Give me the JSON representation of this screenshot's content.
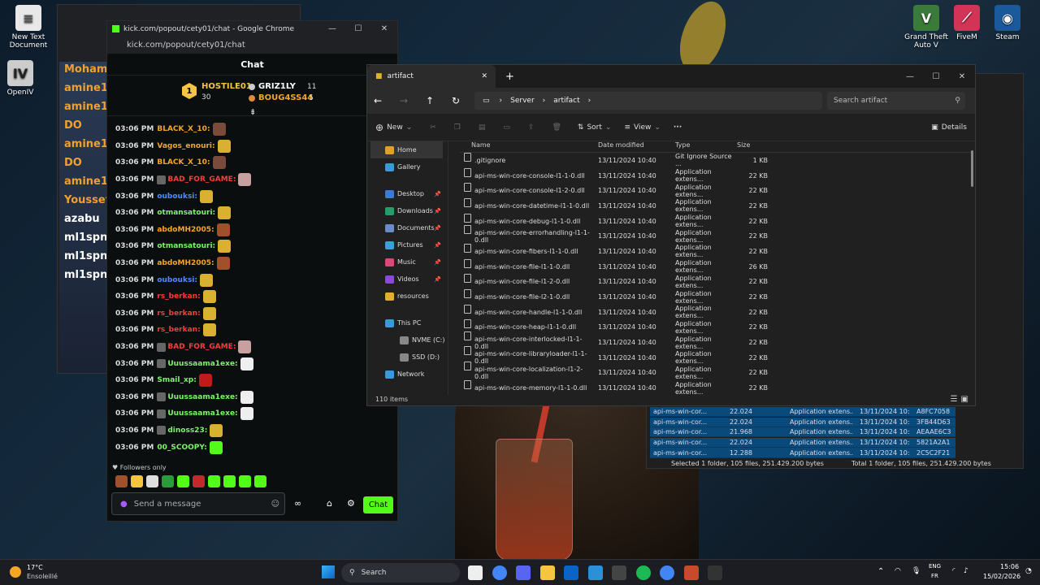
{
  "desktop": {
    "icons": [
      {
        "label": "New Text Document",
        "glyph": "≡",
        "color": "#e8e8e8"
      },
      {
        "label": "OpenIV",
        "glyph": "IV",
        "color": "#cccccc"
      },
      {
        "label": "Grand Theft Auto V",
        "glyph": "V",
        "color": "#3a7a3a"
      },
      {
        "label": "FiveM",
        "glyph": "⟋",
        "color": "#d33356"
      },
      {
        "label": "Steam",
        "glyph": "◉",
        "color": "#1b5a9a"
      }
    ]
  },
  "chat_window": {
    "tab_title": "kick.com/popout/cety01/chat - Google Chrome",
    "url": "kick.com/popout/cety01/chat",
    "header": "Chat",
    "leaderboard": {
      "first_rank": "1",
      "first_name": "HOSTILE01",
      "first_count": "30",
      "second_name": "GRIZ1LY",
      "second_count": "11",
      "third_name": "BOUG4SS44",
      "third_count": "5"
    },
    "messages": [
      {
        "time": "03:06 PM",
        "user": "BLACK_X_10:",
        "color": "#f5a623"
      },
      {
        "time": "03:06 PM",
        "user": "Vagos_enouri:",
        "color": "#f5a623"
      },
      {
        "time": "03:06 PM",
        "user": "BLACK_X_10:",
        "color": "#f5a623"
      },
      {
        "time": "03:06 PM",
        "user": "BAD_FOR_GAME:",
        "color": "#ff3b3b"
      },
      {
        "time": "03:06 PM",
        "user": "oubouksi:",
        "color": "#4c8dff"
      },
      {
        "time": "03:06 PM",
        "user": "otmansatouri:",
        "color": "#7cf56a"
      },
      {
        "time": "03:06 PM",
        "user": "abdoMH2005:",
        "color": "#f5a623"
      },
      {
        "time": "03:06 PM",
        "user": "otmansatouri:",
        "color": "#7cf56a"
      },
      {
        "time": "03:06 PM",
        "user": "abdoMH2005:",
        "color": "#f5a623"
      },
      {
        "time": "03:06 PM",
        "user": "oubouksi:",
        "color": "#4c8dff"
      },
      {
        "time": "03:06 PM",
        "user": "rs_berkan:",
        "color": "#ff3b3b"
      },
      {
        "time": "03:06 PM",
        "user": "rs_berkan:",
        "color": "#ff3b3b"
      },
      {
        "time": "03:06 PM",
        "user": "rs_berkan:",
        "color": "#ff3b3b"
      },
      {
        "time": "03:06 PM",
        "user": "BAD_FOR_GAME:",
        "color": "#ff3b3b"
      },
      {
        "time": "03:06 PM",
        "user": "Uuussaama1exe:",
        "color": "#7cf56a"
      },
      {
        "time": "03:06 PM",
        "user": "Smail_xp:",
        "color": "#7cf56a"
      },
      {
        "time": "03:06 PM",
        "user": "Uuussaama1exe:",
        "color": "#7cf56a"
      },
      {
        "time": "03:06 PM",
        "user": "Uuussaama1exe:",
        "color": "#7cf56a"
      },
      {
        "time": "03:06 PM",
        "user": "dinoss23:",
        "color": "#7cf56a"
      },
      {
        "time": "03:06 PM",
        "user": "00_SCOOPY:",
        "color": "#7cf56a"
      }
    ],
    "followers_only": "Followers only",
    "input_placeholder": "Send a message",
    "send_label": "Chat"
  },
  "bg_chrome": {
    "lines": [
      "Mohamed",
      "amine12la",
      "amine12la",
      "DO",
      "amine12la",
      "DO",
      "amine12la",
      "Youssefm",
      "azabu",
      "ml1spn :",
      "ml1spn :",
      "ml1spn :"
    ]
  },
  "explorer": {
    "tab": "artifact",
    "breadcrumb": [
      "Server",
      "artifact"
    ],
    "search_placeholder": "Search artifact",
    "toolbar": {
      "new": "New",
      "sort": "Sort",
      "view": "View",
      "details": "Details"
    },
    "nav": [
      {
        "label": "Home",
        "color": "#e0a030",
        "pinned": false
      },
      {
        "label": "Gallery",
        "color": "#3a9ad9",
        "pinned": false
      },
      {
        "label": "Desktop",
        "color": "#3a7ad9",
        "pinned": true
      },
      {
        "label": "Downloads",
        "color": "#2a9a6a",
        "pinned": true
      },
      {
        "label": "Documents",
        "color": "#6a8ac9",
        "pinned": true
      },
      {
        "label": "Pictures",
        "color": "#3aa0d9",
        "pinned": true
      },
      {
        "label": "Music",
        "color": "#d94a7a",
        "pinned": true
      },
      {
        "label": "Videos",
        "color": "#8a4ad9",
        "pinned": true
      },
      {
        "label": "resources",
        "color": "#e0b030",
        "pinned": false
      },
      {
        "label": "This PC",
        "color": "#3a9ad9",
        "pinned": false
      },
      {
        "label": "NVME (C:)",
        "color": "#888",
        "pinned": false
      },
      {
        "label": "SSD (D:)",
        "color": "#888",
        "pinned": false
      },
      {
        "label": "Network",
        "color": "#3a9ad9",
        "pinned": false
      }
    ],
    "columns": [
      "Name",
      "Date modified",
      "Type",
      "Size"
    ],
    "files": [
      [
        ".gitignore",
        "13/11/2024 10:40",
        "Git Ignore Source ...",
        "1 KB"
      ],
      [
        "api-ms-win-core-console-l1-1-0.dll",
        "13/11/2024 10:40",
        "Application extens...",
        "22 KB"
      ],
      [
        "api-ms-win-core-console-l1-2-0.dll",
        "13/11/2024 10:40",
        "Application extens...",
        "22 KB"
      ],
      [
        "api-ms-win-core-datetime-l1-1-0.dll",
        "13/11/2024 10:40",
        "Application extens...",
        "22 KB"
      ],
      [
        "api-ms-win-core-debug-l1-1-0.dll",
        "13/11/2024 10:40",
        "Application extens...",
        "22 KB"
      ],
      [
        "api-ms-win-core-errorhandling-l1-1-0.dll",
        "13/11/2024 10:40",
        "Application extens...",
        "22 KB"
      ],
      [
        "api-ms-win-core-fibers-l1-1-0.dll",
        "13/11/2024 10:40",
        "Application extens...",
        "22 KB"
      ],
      [
        "api-ms-win-core-file-l1-1-0.dll",
        "13/11/2024 10:40",
        "Application extens...",
        "26 KB"
      ],
      [
        "api-ms-win-core-file-l1-2-0.dll",
        "13/11/2024 10:40",
        "Application extens...",
        "22 KB"
      ],
      [
        "api-ms-win-core-file-l2-1-0.dll",
        "13/11/2024 10:40",
        "Application extens...",
        "22 KB"
      ],
      [
        "api-ms-win-core-handle-l1-1-0.dll",
        "13/11/2024 10:40",
        "Application extens...",
        "22 KB"
      ],
      [
        "api-ms-win-core-heap-l1-1-0.dll",
        "13/11/2024 10:40",
        "Application extens...",
        "22 KB"
      ],
      [
        "api-ms-win-core-interlocked-l1-1-0.dll",
        "13/11/2024 10:40",
        "Application extens...",
        "22 KB"
      ],
      [
        "api-ms-win-core-libraryloader-l1-1-0.dll",
        "13/11/2024 10:40",
        "Application extens...",
        "22 KB"
      ],
      [
        "api-ms-win-core-localization-l1-2-0.dll",
        "13/11/2024 10:40",
        "Application extens...",
        "22 KB"
      ],
      [
        "api-ms-win-core-memory-l1-1-0.dll",
        "13/11/2024 10:40",
        "Application extens...",
        "22 KB"
      ]
    ],
    "item_count": "110 items"
  },
  "hash_window": {
    "rows": [
      [
        "api-ms-win-cor...",
        "22.024",
        "Application extens...",
        "13/11/2024 10:...",
        "A8FC7058"
      ],
      [
        "api-ms-win-cor...",
        "22.024",
        "Application extens...",
        "13/11/2024 10:...",
        "3FB44D63"
      ],
      [
        "api-ms-win-cor...",
        "21.968",
        "Application extens...",
        "13/11/2024 10:...",
        "AEAAE6C3"
      ],
      [
        "api-ms-win-cor...",
        "22.024",
        "Application extens...",
        "13/11/2024 10:...",
        "5821A2A1"
      ],
      [
        "api-ms-win-cor...",
        "12.288",
        "Application extens...",
        "13/11/2024 10:...",
        "2C5C2F21"
      ]
    ],
    "status_left": "Selected 1 folder, 105 files, 251.429.200 bytes",
    "status_right": "Total 1 folder, 105 files, 251.429.200 bytes"
  },
  "taskbar": {
    "weather_temp": "17°C",
    "weather_desc": "Ensoleillé",
    "search": "Search",
    "lang_top": "ENG",
    "lang_bottom": "FR",
    "time": "15:06",
    "date": "15/02/2026",
    "app_colors": [
      "#eee",
      "#4285f4",
      "#5865f2",
      "#f5c542",
      "#0a64c8",
      "#2c90d9",
      "#444",
      "#1db954",
      "#4285f4",
      "#c94a2a",
      "#333"
    ]
  }
}
